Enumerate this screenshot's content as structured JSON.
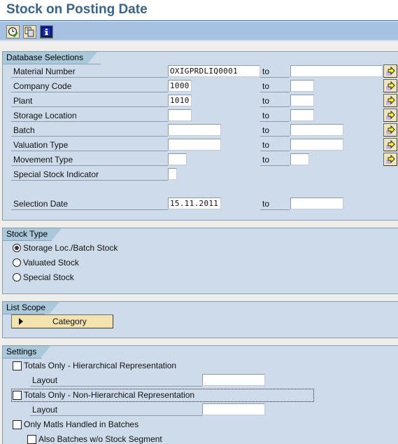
{
  "header": {
    "title": "Stock on Posting Date"
  },
  "toolbar": {
    "buttons": [
      {
        "name": "execute",
        "icon": "clock-check-icon"
      },
      {
        "name": "get-variant",
        "icon": "copy-pages-icon"
      },
      {
        "name": "info",
        "icon": "info-icon"
      }
    ]
  },
  "db_selections": {
    "title": "Database Selections",
    "to_label": "to",
    "rows": [
      {
        "label": "Material Number",
        "from": "OXIGPRDLIQ0001",
        "to": "",
        "has_range": true,
        "has_more": true
      },
      {
        "label": "Company Code",
        "from": "1000",
        "to": "",
        "has_range": true,
        "has_more": true
      },
      {
        "label": "Plant",
        "from": "1010",
        "to": "",
        "has_range": true,
        "has_more": true
      },
      {
        "label": "Storage Location",
        "from": "",
        "to": "",
        "has_range": true,
        "has_more": true
      },
      {
        "label": "Batch",
        "from": "",
        "to": "",
        "has_range": true,
        "has_more": true
      },
      {
        "label": "Valuation Type",
        "from": "",
        "to": "",
        "has_range": true,
        "has_more": true
      },
      {
        "label": "Movement Type",
        "from": "",
        "to": "",
        "has_range": true,
        "has_more": true
      },
      {
        "label": "Special Stock Indicator",
        "from": "",
        "has_range": false,
        "has_more": false
      }
    ],
    "selection_date": {
      "label": "Selection Date",
      "from": "15.11.2011",
      "to": ""
    }
  },
  "stock_type": {
    "title": "Stock Type",
    "options": [
      {
        "label": "Storage Loc./Batch Stock",
        "selected": true
      },
      {
        "label": "Valuated Stock",
        "selected": false
      },
      {
        "label": "Special Stock",
        "selected": false
      }
    ]
  },
  "list_scope": {
    "title": "List Scope",
    "button_label": "Category"
  },
  "settings": {
    "title": "Settings",
    "totals_hier": {
      "label": "Totals Only - Hierarchical Representation",
      "checked": false
    },
    "layout1": {
      "label": "Layout",
      "value": ""
    },
    "totals_nonhier": {
      "label": "Totals Only - Non-Hierarchical Representation",
      "checked": false
    },
    "layout2": {
      "label": "Layout",
      "value": ""
    },
    "only_batches": {
      "label": "Only Matls Handled in Batches",
      "checked": false
    },
    "also_batches": {
      "label": "Also Batches w/o Stock Segment",
      "checked": false
    }
  }
}
